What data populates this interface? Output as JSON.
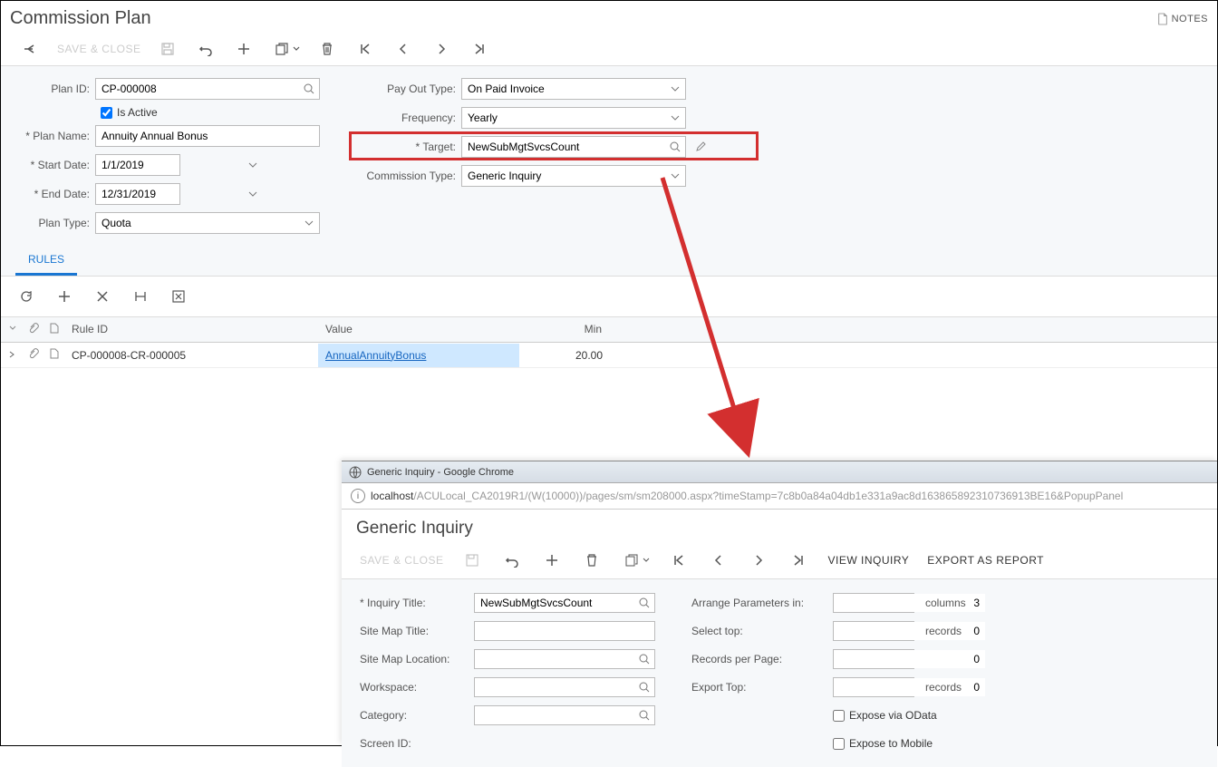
{
  "header": {
    "title": "Commission Plan",
    "notes": "NOTES"
  },
  "toolbar": {
    "save_close": "SAVE & CLOSE"
  },
  "form": {
    "plan_id_label": "Plan ID:",
    "plan_id": "CP-000008",
    "is_active_label": "Is Active",
    "plan_name_label": "Plan Name:",
    "plan_name": "Annuity Annual Bonus",
    "start_date_label": "Start Date:",
    "start_date": "1/1/2019",
    "end_date_label": "End Date:",
    "end_date": "12/31/2019",
    "plan_type_label": "Plan Type:",
    "plan_type": "Quota",
    "pay_out_label": "Pay Out Type:",
    "pay_out": "On Paid Invoice",
    "frequency_label": "Frequency:",
    "frequency": "Yearly",
    "target_label": "Target:",
    "target": "NewSubMgtSvcsCount",
    "commission_type_label": "Commission Type:",
    "commission_type": "Generic Inquiry"
  },
  "tabs": {
    "rules": "RULES"
  },
  "grid": {
    "headers": {
      "rule_id": "Rule ID",
      "value": "Value",
      "min": "Min"
    },
    "rows": [
      {
        "rule_id": "CP-000008-CR-000005",
        "value": "AnnualAnnuityBonus",
        "min": "20.00"
      }
    ]
  },
  "chrome": {
    "title": "Generic Inquiry - Google Chrome",
    "url_host": "localhost",
    "url_rest": "/ACULocal_CA2019R1/(W(10000))/pages/sm/sm208000.aspx?timeStamp=7c8b0a84a04db1e331a9ac8d163865892310736913BE16&PopupPanel"
  },
  "gi": {
    "title": "Generic Inquiry",
    "toolbar": {
      "save_close": "SAVE & CLOSE",
      "view": "VIEW INQUIRY",
      "export": "EXPORT AS REPORT"
    },
    "form": {
      "inquiry_title_label": "Inquiry Title:",
      "inquiry_title": "NewSubMgtSvcsCount",
      "site_map_title_label": "Site Map Title:",
      "site_map_location_label": "Site Map Location:",
      "workspace_label": "Workspace:",
      "category_label": "Category:",
      "screen_id_label": "Screen ID:",
      "arrange_label": "Arrange Parameters in:",
      "arrange_val": "3",
      "arrange_suffix": "columns",
      "select_top_label": "Select top:",
      "select_top_val": "0",
      "select_top_suffix": "records",
      "records_page_label": "Records per Page:",
      "records_page_val": "0",
      "export_top_label": "Export Top:",
      "export_top_val": "0",
      "export_top_suffix": "records",
      "expose_odata": "Expose via OData",
      "expose_mobile": "Expose to Mobile"
    }
  }
}
